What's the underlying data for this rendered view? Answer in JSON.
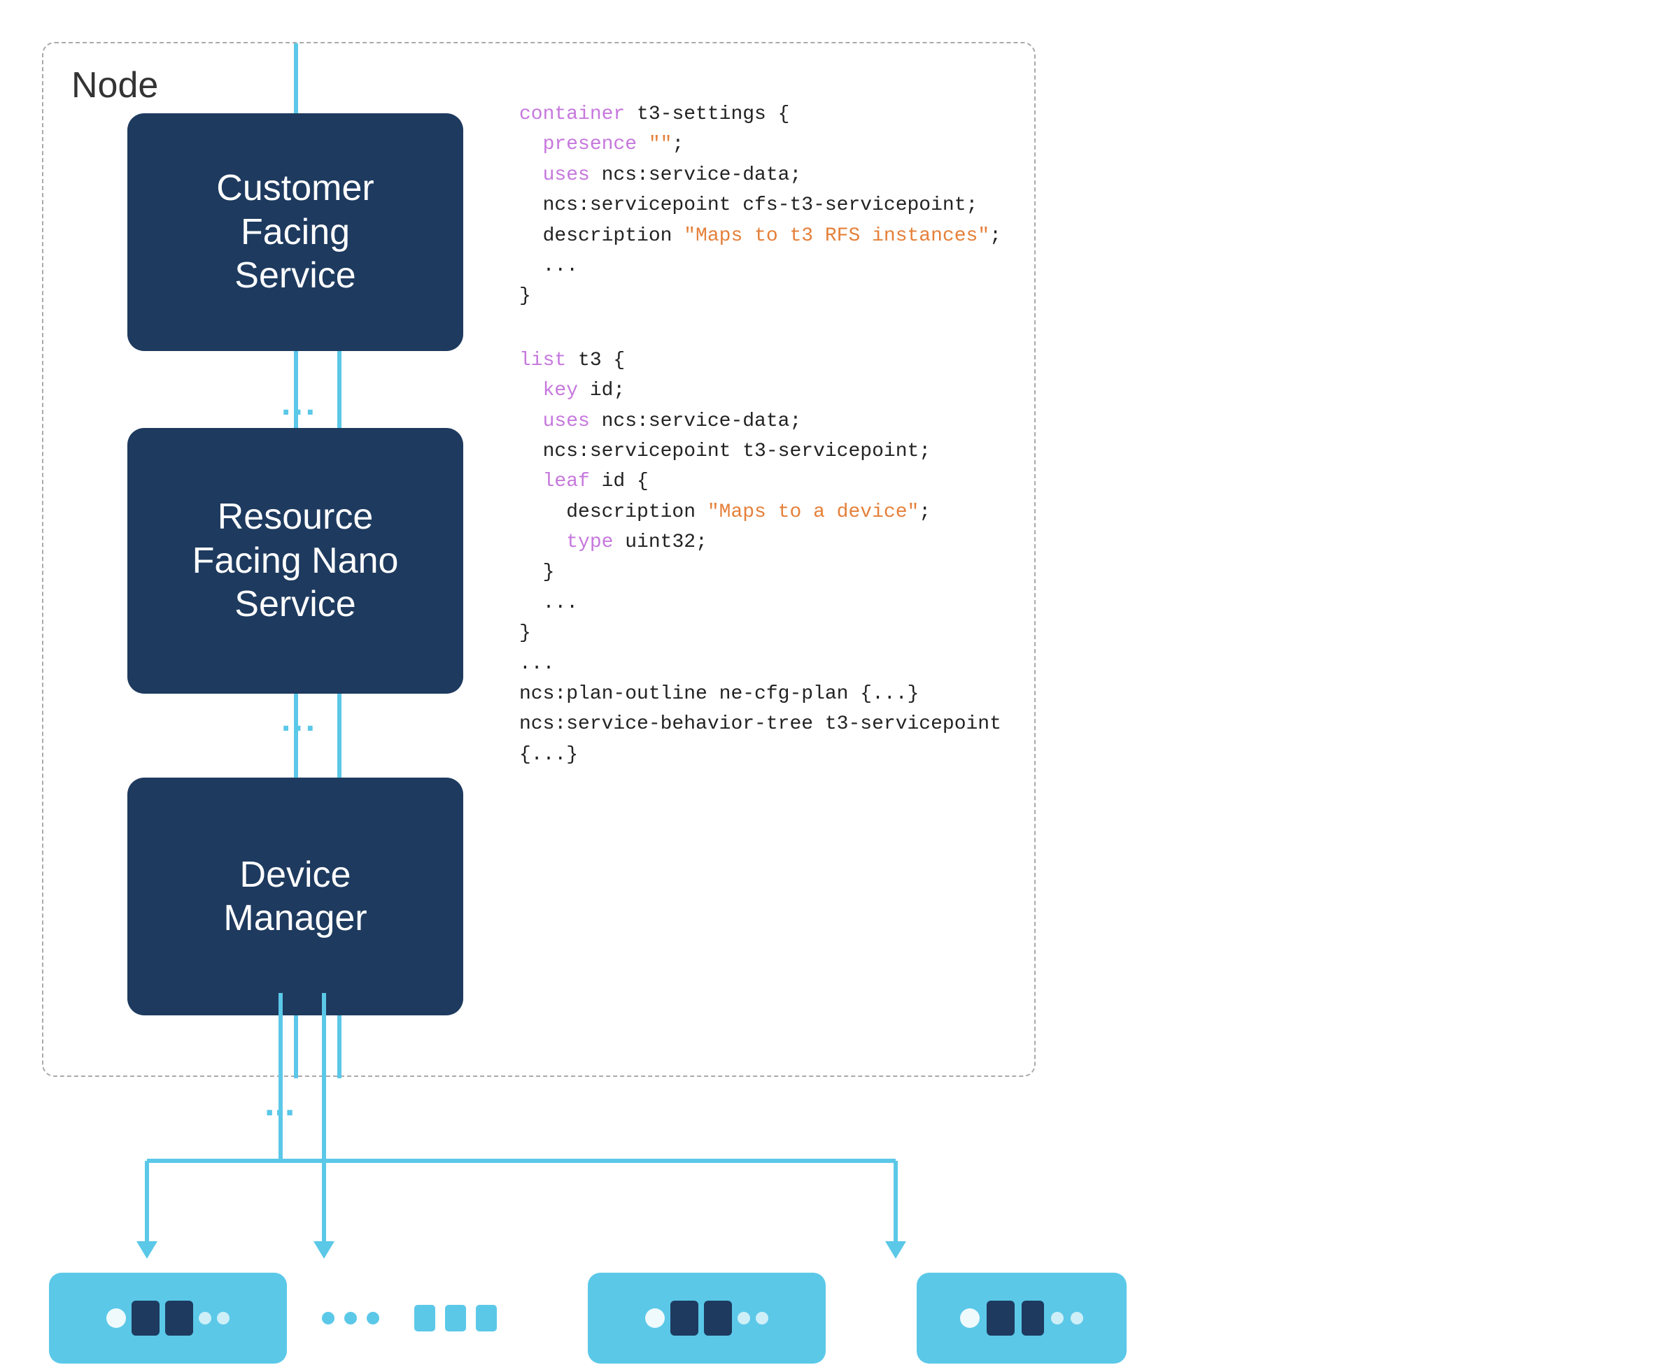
{
  "node_label": "Node",
  "services": {
    "cfs": {
      "label": "Customer\nFacing\nService"
    },
    "rfns": {
      "label": "Resource\nFacing Nano\nService"
    },
    "dm": {
      "label": "Device\nManager"
    }
  },
  "code": {
    "block1": [
      {
        "type": "kw-purple",
        "text": "container "
      },
      {
        "type": "plain",
        "text": "t3-settings {"
      },
      {
        "type": "newline"
      },
      {
        "type": "indent2"
      },
      {
        "type": "kw-purple",
        "text": "presence "
      },
      {
        "type": "str-orange",
        "text": "\"\""
      },
      {
        "type": "plain",
        "text": ";"
      },
      {
        "type": "newline"
      },
      {
        "type": "indent2"
      },
      {
        "type": "kw-purple",
        "text": "uses "
      },
      {
        "type": "plain",
        "text": "ncs:service-data;"
      },
      {
        "type": "newline"
      },
      {
        "type": "indent2"
      },
      {
        "type": "plain",
        "text": "ncs:servicepoint cfs-t3-servicepoint;"
      },
      {
        "type": "newline"
      },
      {
        "type": "indent2"
      },
      {
        "type": "plain",
        "text": "description "
      },
      {
        "type": "str-orange",
        "text": "\"Maps to t3 RFS instances\""
      },
      {
        "type": "plain",
        "text": ";"
      },
      {
        "type": "newline"
      },
      {
        "type": "indent2"
      },
      {
        "type": "plain",
        "text": "..."
      },
      {
        "type": "newline"
      },
      {
        "type": "plain",
        "text": "}"
      }
    ],
    "block2": [
      {
        "type": "kw-purple",
        "text": "list "
      },
      {
        "type": "plain",
        "text": "t3 {"
      },
      {
        "type": "newline"
      },
      {
        "type": "indent2"
      },
      {
        "type": "kw-purple",
        "text": "key "
      },
      {
        "type": "plain",
        "text": "id;"
      },
      {
        "type": "newline"
      },
      {
        "type": "indent2"
      },
      {
        "type": "kw-purple",
        "text": "uses "
      },
      {
        "type": "plain",
        "text": "ncs:service-data;"
      },
      {
        "type": "newline"
      },
      {
        "type": "indent2"
      },
      {
        "type": "plain",
        "text": "ncs:servicepoint t3-servicepoint;"
      },
      {
        "type": "newline"
      },
      {
        "type": "indent2"
      },
      {
        "type": "kw-purple",
        "text": "leaf "
      },
      {
        "type": "plain",
        "text": "id {"
      },
      {
        "type": "newline"
      },
      {
        "type": "indent4"
      },
      {
        "type": "plain",
        "text": "description "
      },
      {
        "type": "str-orange",
        "text": "\"Maps to a device\""
      },
      {
        "type": "plain",
        "text": ";"
      },
      {
        "type": "newline"
      },
      {
        "type": "indent4"
      },
      {
        "type": "kw-purple",
        "text": "type "
      },
      {
        "type": "plain",
        "text": "uint32;"
      },
      {
        "type": "newline"
      },
      {
        "type": "indent2"
      },
      {
        "type": "plain",
        "text": "}"
      },
      {
        "type": "newline"
      },
      {
        "type": "indent2"
      },
      {
        "type": "plain",
        "text": "..."
      },
      {
        "type": "newline"
      },
      {
        "type": "plain",
        "text": "}"
      },
      {
        "type": "newline"
      },
      {
        "type": "plain",
        "text": "..."
      },
      {
        "type": "newline"
      },
      {
        "type": "plain",
        "text": "ncs:plan-outline ne-cfg-plan {...}"
      },
      {
        "type": "newline"
      },
      {
        "type": "plain",
        "text": "ncs:service-behavior-tree t3-servicepoint {...}"
      }
    ]
  },
  "dots": "...",
  "colors": {
    "accent": "#5bc8e8",
    "dark_blue": "#1e3a5f",
    "purple": "#c678dd",
    "orange": "#e5803a",
    "blue_kw": "#61afef"
  }
}
